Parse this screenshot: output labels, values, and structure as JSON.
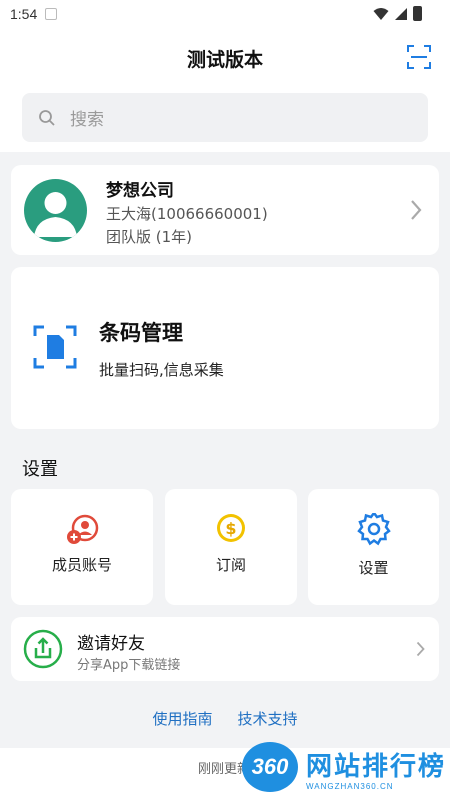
{
  "status_bar": {
    "time": "1:54"
  },
  "header": {
    "title": "测试版本"
  },
  "search": {
    "placeholder": "搜索"
  },
  "company": {
    "name": "梦想公司",
    "user": "王大海(10066660001)",
    "plan": "团队版 (1年)",
    "avatar_color": "#2a9d7f"
  },
  "barcode": {
    "title": "条码管理",
    "subtitle": "批量扫码,信息采集",
    "icon_color": "#1f7de2"
  },
  "settings_section": {
    "title": "设置",
    "tiles": [
      {
        "label": "成员账号",
        "icon": "member-account-icon",
        "color": "#e04a3a"
      },
      {
        "label": "订阅",
        "icon": "dollar-coin-icon",
        "color": "#e6b800"
      },
      {
        "label": "设置",
        "icon": "gear-icon",
        "color": "#1f7de2"
      }
    ]
  },
  "invite": {
    "title": "邀请好友",
    "subtitle": "分享App下载链接",
    "icon_color": "#27ae4a"
  },
  "links": {
    "guide": "使用指南",
    "support": "技术支持"
  },
  "footer": {
    "text": "刚刚更新"
  },
  "watermark": {
    "logo": "360",
    "brand": "网站排行榜",
    "url": "WANGZHAN360.CN"
  }
}
